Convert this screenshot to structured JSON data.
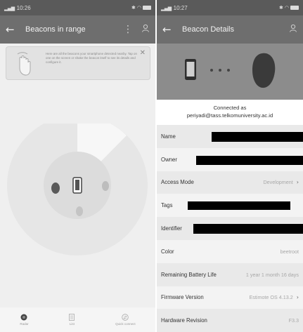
{
  "left_screen": {
    "status_time": "10:26",
    "title": "Beacons in range",
    "tip_text": "Here are all the beacons your smartphone detected nearby. Tap on one on the screen or shake the beacon itself to see its details and configure it.",
    "bottom_nav": [
      {
        "label": "Radar"
      },
      {
        "label": "List"
      },
      {
        "label": "Quick connect"
      }
    ]
  },
  "right_screen": {
    "status_time": "10:27",
    "title": "Beacon Details",
    "connected_line1": "Connected as",
    "connected_line2": "periyadi@tass.telkomuniversity.ac.id",
    "rows": [
      {
        "label": "Name",
        "value": ""
      },
      {
        "label": "Owner",
        "value": ""
      },
      {
        "label": "Access Mode",
        "value": "Development"
      },
      {
        "label": "Tags",
        "value": ""
      },
      {
        "label": "Identifier",
        "value": ""
      },
      {
        "label": "Color",
        "value": "beetroot"
      },
      {
        "label": "Remaining Battery Life",
        "value": "1 year 1 month 16 days"
      },
      {
        "label": "Firmware Version",
        "value": "Estimote OS 4.13.2"
      },
      {
        "label": "Hardware Revision",
        "value": "F3.3"
      }
    ]
  },
  "colors": {
    "appbar": "#6e6e6e",
    "statusbar": "#5a5a5a",
    "hero": "#8c8c8c"
  }
}
